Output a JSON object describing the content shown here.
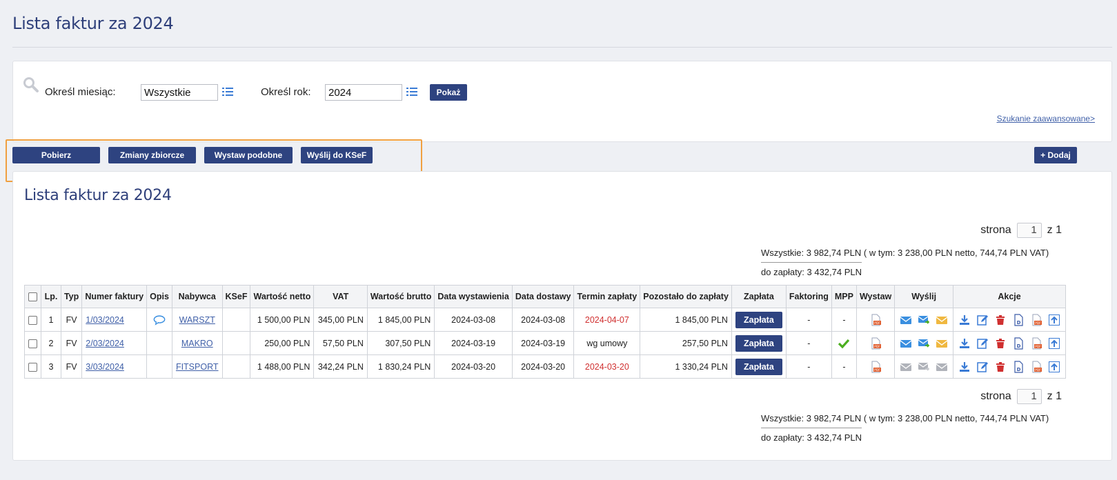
{
  "page": {
    "title": "Lista faktur za 2024"
  },
  "search": {
    "month_label": "Określ miesiąc:",
    "month_value": "Wszystkie",
    "year_label": "Określ rok:",
    "year_value": "2024",
    "show_button": "Pokaż",
    "advanced_link": "Szukanie zaawansowane>"
  },
  "actions": {
    "download": "Pobierz",
    "bulk_changes": "Zmiany zbiorcze",
    "issue_similar": "Wystaw podobne",
    "send_ksef": "Wyślij do KSeF",
    "add": "+ Dodaj"
  },
  "list": {
    "title": "Lista faktur za 2024",
    "pager_label": "strona",
    "pager_value": "1",
    "pager_of": "z 1",
    "totals_all_label": "Wszystkie:",
    "totals_all_value": "3 982,74 PLN",
    "totals_breakdown": "( w tym: 3 238,00 PLN netto, 744,74 PLN VAT)",
    "totals_due_label": "do zapłaty:",
    "totals_due_value": "3 432,74 PLN",
    "columns": [
      "Lp.",
      "Typ",
      "Numer faktury",
      "Opis",
      "Nabywca",
      "KSeF",
      "Wartość netto",
      "VAT",
      "Wartość brutto",
      "Data wystawienia",
      "Data dostawy",
      "Termin zapłaty",
      "Pozostało do zapłaty",
      "Zapłata",
      "Faktoring",
      "MPP",
      "Wystaw",
      "Wyślij",
      "Akcje"
    ],
    "pay_label": "Zapłata",
    "rows": [
      {
        "lp": "1",
        "typ": "FV",
        "numer": "1/03/2024",
        "nabywca": "WARSZT",
        "netto": "1 500,00 PLN",
        "vat": "345,00 PLN",
        "brutto": "1 845,00 PLN",
        "wystawienia": "2024-03-08",
        "dostawy": "2024-03-08",
        "termin": "2024-04-07",
        "pozostalo": "1 845,00 PLN",
        "faktoring": "-",
        "mpp": "-"
      },
      {
        "lp": "2",
        "typ": "FV",
        "numer": "2/03/2024",
        "nabywca": "MAKRO",
        "netto": "250,00 PLN",
        "vat": "57,50 PLN",
        "brutto": "307,50 PLN",
        "wystawienia": "2024-03-19",
        "dostawy": "2024-03-19",
        "termin": "wg umowy",
        "pozostalo": "257,50 PLN",
        "faktoring": "-",
        "mpp": ""
      },
      {
        "lp": "3",
        "typ": "FV",
        "numer": "3/03/2024",
        "nabywca": "FITSPORT",
        "netto": "1 488,00 PLN",
        "vat": "342,24 PLN",
        "brutto": "1 830,24 PLN",
        "wystawienia": "2024-03-20",
        "dostawy": "2024-03-20",
        "termin": "2024-03-20",
        "pozostalo": "1 330,24 PLN",
        "faktoring": "-",
        "mpp": "-"
      }
    ]
  },
  "colors": {
    "primary": "#2e4380",
    "title": "#2e3f7a",
    "link": "#4060a8",
    "overdue": "#d03030",
    "highlight": "#f0a040"
  }
}
